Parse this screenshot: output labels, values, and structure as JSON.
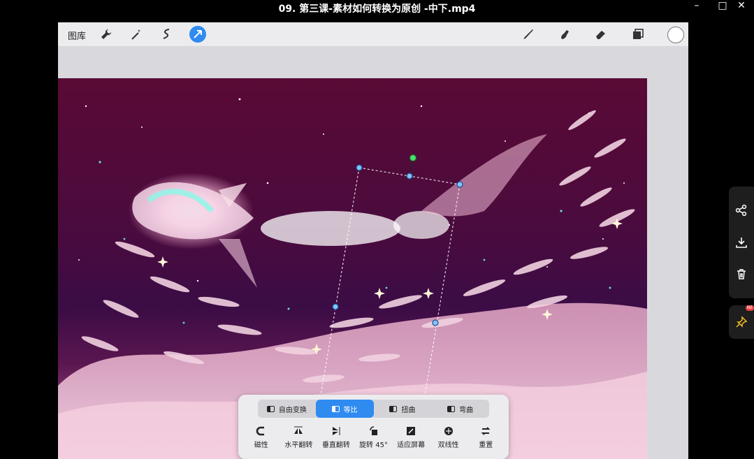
{
  "window": {
    "title": "09. 第三课-素材如何转换为原创 -中下.mp4",
    "controls": [
      "–",
      "□",
      "✕"
    ]
  },
  "toolbar": {
    "gallery_label": "图库",
    "left_tools": [
      "wrench-icon",
      "magic-wand-icon",
      "selection-icon",
      "transform-arrow-icon"
    ],
    "right_tools": [
      "brush-icon",
      "smudge-icon",
      "eraser-icon",
      "layers-icon"
    ],
    "active_tool": "transform-arrow-icon",
    "current_color": "#ffffff",
    "accent": "#2f8bf0"
  },
  "transform_panel": {
    "modes": [
      {
        "label": "自由变换",
        "selected": false
      },
      {
        "label": "等比",
        "selected": true
      },
      {
        "label": "扭曲",
        "selected": false
      },
      {
        "label": "弯曲",
        "selected": false
      }
    ],
    "actions": [
      {
        "label": "磁性",
        "icon": "magnet-icon"
      },
      {
        "label": "水平翻转",
        "icon": "flip-horizontal-icon"
      },
      {
        "label": "垂直翻转",
        "icon": "flip-vertical-icon"
      },
      {
        "label": "旋转 45°",
        "icon": "rotate-icon"
      },
      {
        "label": "适应屏幕",
        "icon": "fit-screen-icon"
      },
      {
        "label": "双线性",
        "icon": "bilinear-icon"
      },
      {
        "label": "重置",
        "icon": "reset-icon"
      }
    ]
  },
  "side_panel": {
    "icons": [
      "share-icon",
      "download-icon",
      "trash-icon",
      "pin-icon"
    ],
    "badge": "NE"
  }
}
